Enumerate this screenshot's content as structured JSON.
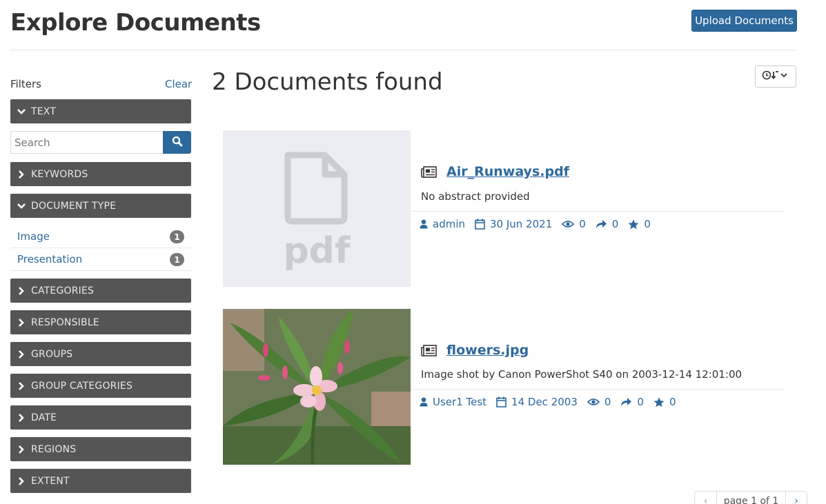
{
  "header": {
    "title": "Explore Documents",
    "upload_label": "Upload Documents"
  },
  "sidebar": {
    "filters_label": "Filters",
    "clear_label": "Clear",
    "search_placeholder": "Search",
    "facets": {
      "text": "TEXT",
      "keywords": "KEYWORDS",
      "document_type": "DOCUMENT TYPE",
      "categories": "CATEGORIES",
      "responsible": "RESPONSIBLE",
      "groups": "GROUPS",
      "group_categories": "GROUP CATEGORIES",
      "date": "DATE",
      "regions": "REGIONS",
      "extent": "EXTENT"
    },
    "document_types": [
      {
        "label": "Image",
        "count": "1"
      },
      {
        "label": "Presentation",
        "count": "1"
      }
    ]
  },
  "results": {
    "count_title": "2 Documents found",
    "items": [
      {
        "title": "Air_Runways.pdf",
        "abstract": "No abstract provided",
        "owner": "admin",
        "date": "30 Jun 2021",
        "views": "0",
        "shares": "0",
        "rating": "0",
        "thumbnail": "pdf-placeholder"
      },
      {
        "title": "flowers.jpg",
        "abstract": "Image shot by Canon PowerShot S40 on 2003-12-14 12:01:00",
        "owner": "User1 Test",
        "date": "14 Dec 2003",
        "views": "0",
        "shares": "0",
        "rating": "0",
        "thumbnail": "flower-photo"
      }
    ],
    "pagination": {
      "label": "page 1 of 1"
    }
  },
  "colors": {
    "accent": "#2c689c",
    "facet_bg": "#555555",
    "badge_bg": "#777777"
  }
}
